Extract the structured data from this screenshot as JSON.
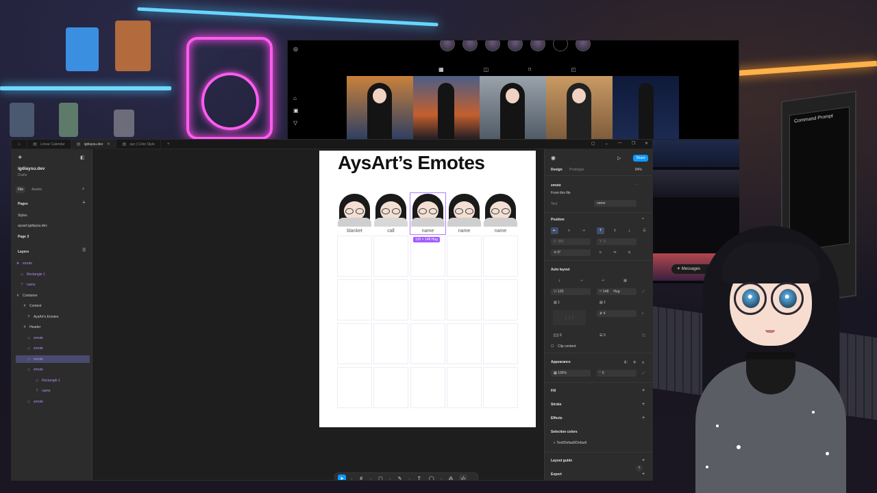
{
  "browser": {
    "tabs": [
      {
        "label": "Linear Calendar",
        "icon": "figma-file-icon"
      },
      {
        "label": "igdiaysu.dev",
        "icon": "figma-file-icon",
        "active": true
      },
      {
        "label": "ays | Color Style",
        "icon": "figma-file-icon"
      }
    ]
  },
  "instagram": {
    "story_count": 7,
    "thumbnail_count": 5,
    "messages_label": "Messages"
  },
  "figma": {
    "file_name": "igdiaysu.dev",
    "file_location": "Drafts",
    "left_tabs": [
      "File",
      "Assets"
    ],
    "pages_header": "Pages",
    "pages": [
      "Styles",
      "aysart.igdiaysu.dev",
      "Page 3"
    ],
    "layers_header": "Layers",
    "layers": [
      {
        "name": "emote",
        "icon": "component-icon",
        "depth": 0,
        "purple": true
      },
      {
        "name": "Rectangle 1",
        "icon": "rectangle-icon",
        "depth": 1,
        "purple": true
      },
      {
        "name": "name",
        "icon": "text-icon",
        "depth": 1,
        "purple": true
      },
      {
        "name": "Container",
        "icon": "frame-icon",
        "depth": 0
      },
      {
        "name": "Content",
        "icon": "frame-icon",
        "depth": 1
      },
      {
        "name": "AysArt's Emotes",
        "icon": "text-icon",
        "depth": 2
      },
      {
        "name": "Header",
        "icon": "frame-icon",
        "depth": 1
      },
      {
        "name": "emote",
        "icon": "instance-icon",
        "depth": 2,
        "purple": true
      },
      {
        "name": "emote",
        "icon": "instance-icon",
        "depth": 2,
        "purple": true
      },
      {
        "name": "emote",
        "icon": "instance-icon",
        "depth": 2,
        "purple": true,
        "selected": true
      },
      {
        "name": "emote",
        "icon": "instance-icon",
        "depth": 2,
        "purple": true
      },
      {
        "name": "Rectangle 1",
        "icon": "rectangle-icon",
        "depth": 3,
        "purple": true
      },
      {
        "name": "name",
        "icon": "text-icon",
        "depth": 3,
        "purple": true
      },
      {
        "name": "emote",
        "icon": "instance-icon",
        "depth": 2,
        "purple": true
      }
    ],
    "canvas": {
      "frame_title": "AysArt’s Emotes",
      "emote_labels": [
        "blanket",
        "call",
        "name",
        "name",
        "name"
      ],
      "selection_size": "120 × 148 Hug",
      "empty_rows": 4
    },
    "toolbar": [
      "move-tool-icon",
      "frame-tool-icon",
      "shape-tool-icon",
      "pen-tool-icon",
      "text-tool-icon",
      "comment-tool-icon",
      "actions-icon",
      "dev-mode-icon"
    ],
    "right_panel": {
      "tabs": [
        "Design",
        "Prototype"
      ],
      "zoom": "84%",
      "share_label": "Share",
      "component_name": "emote",
      "component_source": "From this file",
      "prop_label": "Text",
      "prop_value": "name",
      "position_header": "Position",
      "x_label": "X",
      "x_value": "360",
      "y_label": "Y",
      "y_value": "0",
      "rotation": "0°",
      "auto_layout_header": "Auto layout",
      "w_label": "W",
      "w_value": "120",
      "h_label": "H",
      "h_value": "148",
      "h_mode": "Hug",
      "gap_a": "1",
      "gap_b": "1",
      "gap_c": "4",
      "pad_a": "0",
      "pad_b": "0",
      "clip_content": "Clip content",
      "appearance_header": "Appearance",
      "opacity": "100%",
      "radius": "0",
      "fill_header": "Fill",
      "stroke_header": "Stroke",
      "effects_header": "Effects",
      "selection_colors_header": "Selection colors",
      "selection_color_value": "Text/Default/Default",
      "layout_guide_header": "Layout guide",
      "export_header": "Export",
      "help": "?"
    }
  },
  "colors": {
    "accent": "#0d99ff",
    "component_purple": "#a259ff",
    "panel_bg": "#2c2c2c"
  }
}
